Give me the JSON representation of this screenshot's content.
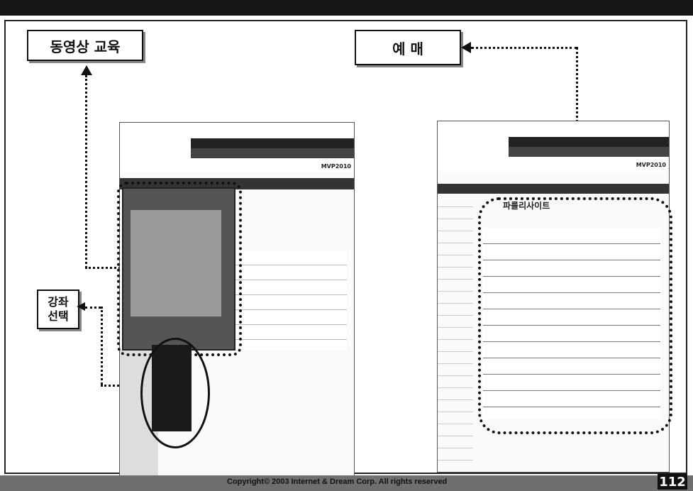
{
  "labels": {
    "video_education": "동영상 교육",
    "booking": "예 매",
    "course_select_line1": "강좌",
    "course_select_line2": "선택"
  },
  "right_screen": {
    "brand": "MVP2010",
    "panel_title": "파를리사이트"
  },
  "left_screen": {
    "brand": "MVP2010"
  },
  "footer": {
    "copyright": "Copyright© 2003 Internet & Dream Corp. All rights reserved",
    "page": "112"
  }
}
